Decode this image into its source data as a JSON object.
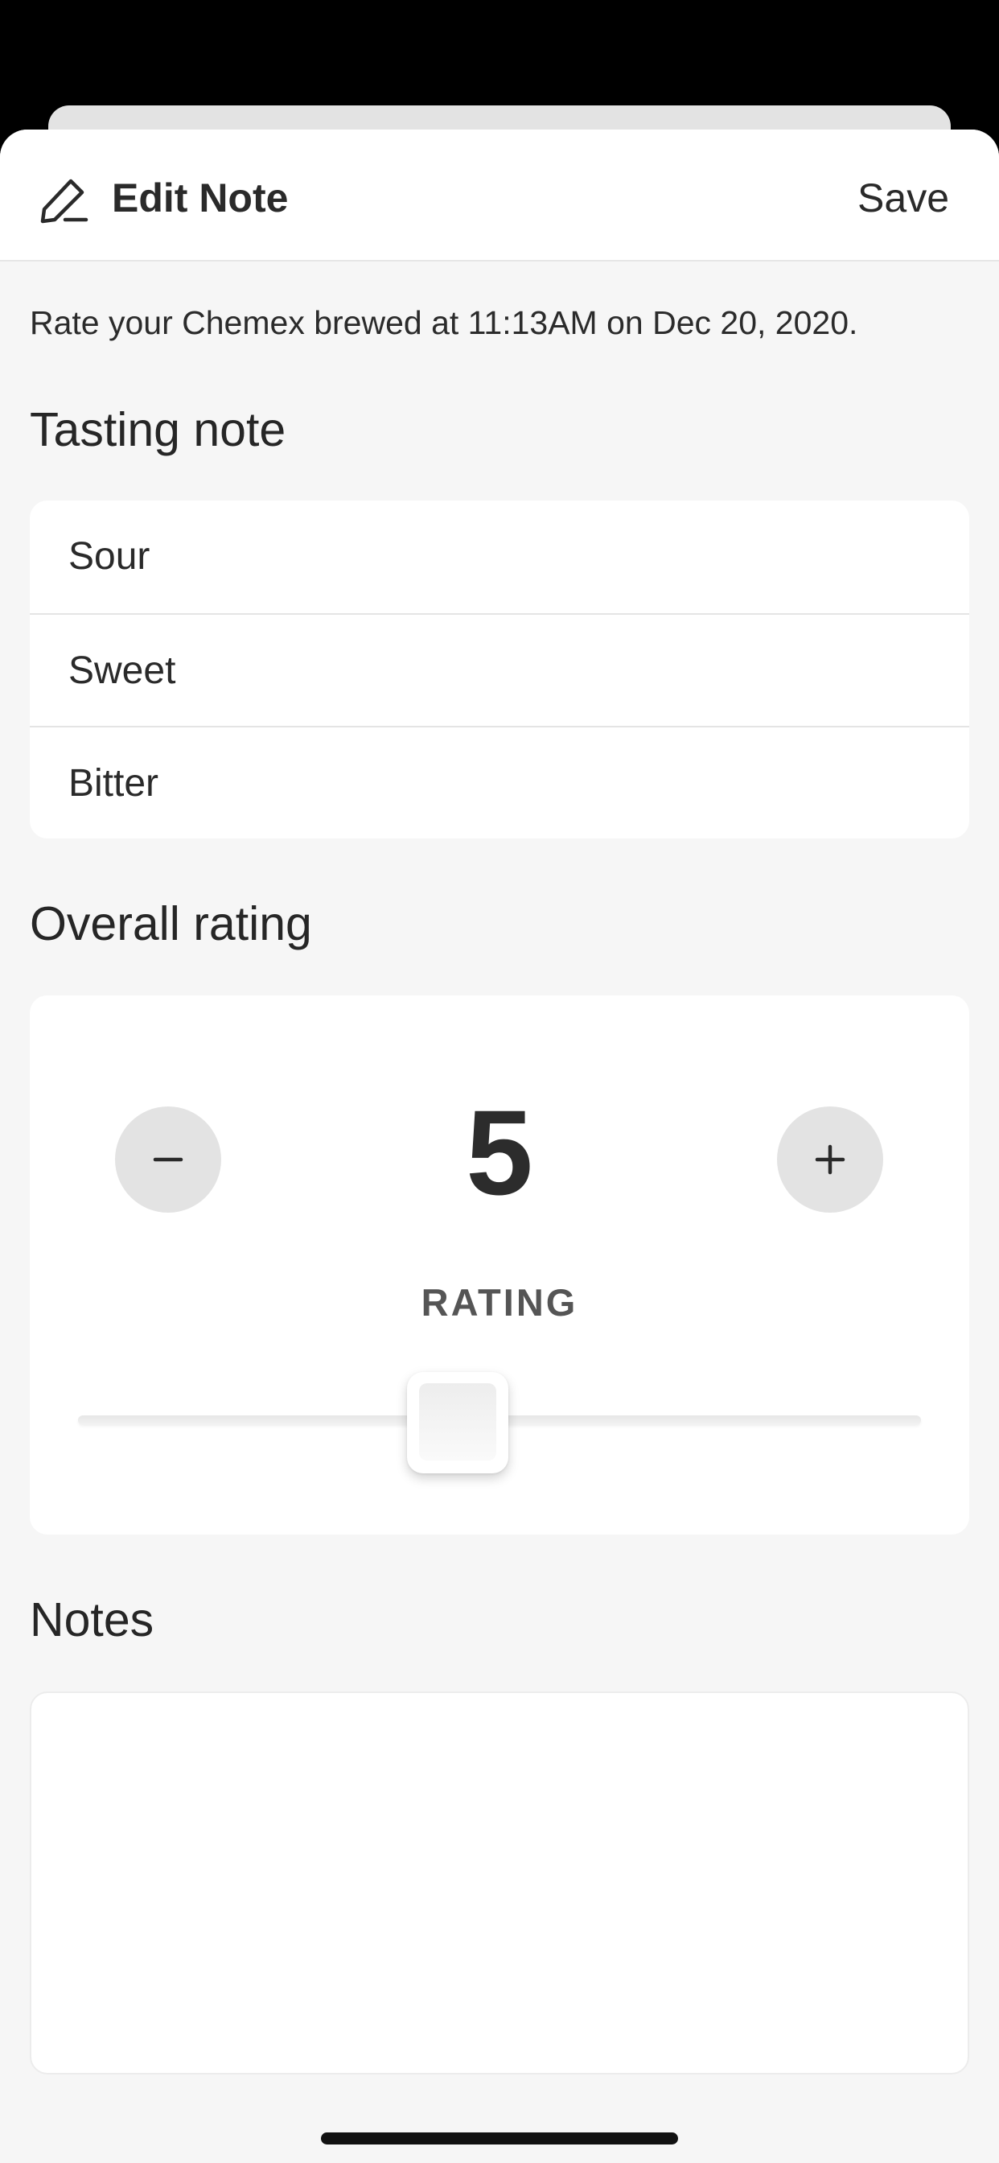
{
  "header": {
    "title": "Edit Note",
    "save_label": "Save"
  },
  "subtitle": "Rate your Chemex brewed at 11:13AM on Dec 20, 2020.",
  "tasting": {
    "title": "Tasting note",
    "items": [
      {
        "label": "Sour"
      },
      {
        "label": "Sweet"
      },
      {
        "label": "Bitter"
      }
    ]
  },
  "rating": {
    "title": "Overall rating",
    "value": "5",
    "label": "RATING",
    "slider_fraction": 0.45
  },
  "notes": {
    "title": "Notes",
    "value": "",
    "placeholder": ""
  },
  "icons": {
    "edit": "pencil-icon",
    "decrement": "minus-icon",
    "increment": "plus-icon"
  },
  "colors": {
    "background": "#f6f6f6",
    "card": "#ffffff",
    "text": "#2a2a2a",
    "step_button": "#e3e3e3"
  }
}
